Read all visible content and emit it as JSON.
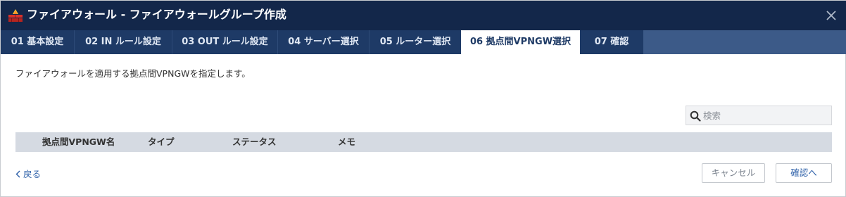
{
  "window": {
    "title": "ファイアウォール - ファイアウォールグループ作成",
    "icon": "firewall-icon",
    "close_icon": "close-icon"
  },
  "tabs": [
    {
      "label": "01 基本設定",
      "active": false
    },
    {
      "label": "02 IN ルール設定",
      "active": false
    },
    {
      "label": "03 OUT ルール設定",
      "active": false
    },
    {
      "label": "04 サーバー選択",
      "active": false
    },
    {
      "label": "05 ルーター選択",
      "active": false
    },
    {
      "label": "06 拠点間VPNGW選択",
      "active": true
    },
    {
      "label": "07 確認",
      "active": false
    }
  ],
  "description": "ファイアウォールを適用する拠点間VPNGWを指定します。",
  "search": {
    "placeholder": "検索",
    "value": "",
    "icon": "search-icon"
  },
  "table": {
    "columns": [
      "拠点間VPNGW名",
      "タイプ",
      "ステータス",
      "メモ"
    ],
    "rows": []
  },
  "footer": {
    "back_label": "戻る",
    "cancel_label": "キャンセル",
    "confirm_label": "確認へ"
  },
  "colors": {
    "titlebar": "#13274a",
    "tabbar": "#1e3a66",
    "accent": "#2c5fa8",
    "table_header": "#d5dae2"
  }
}
